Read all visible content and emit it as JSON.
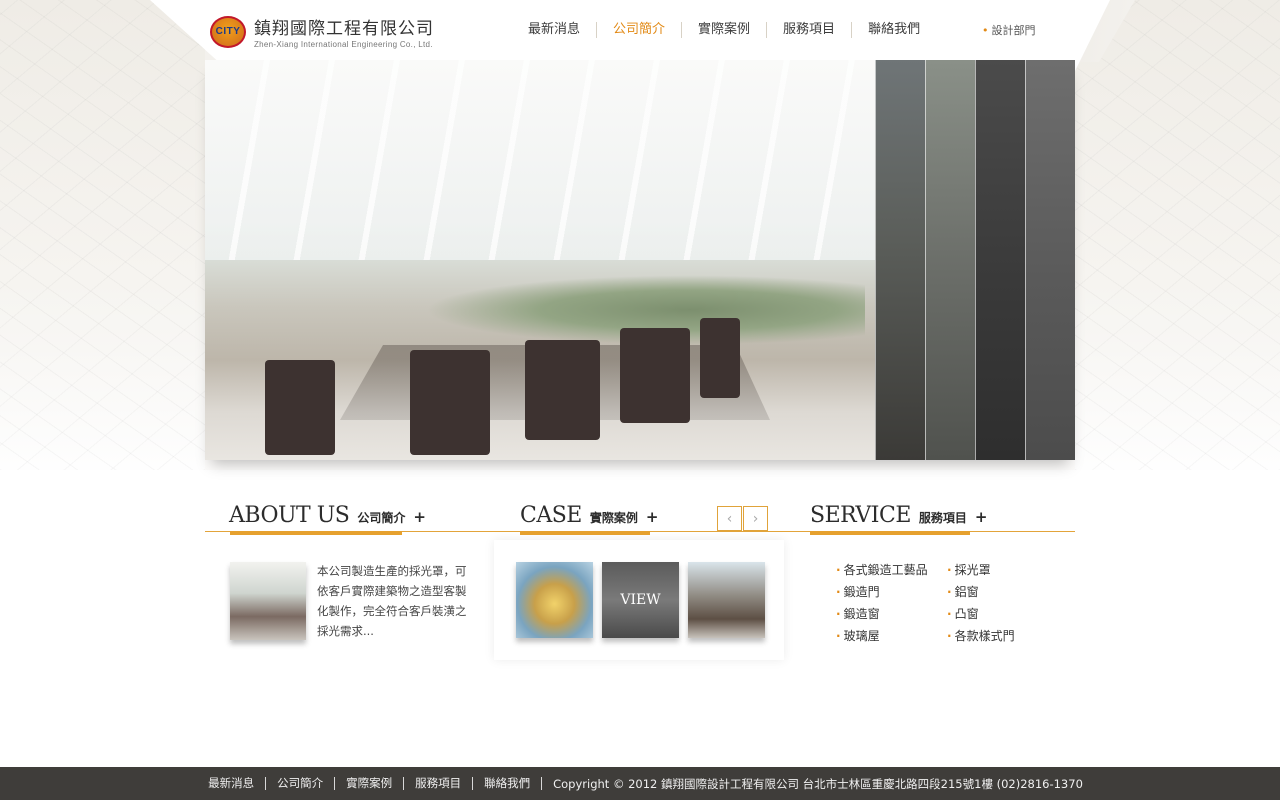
{
  "brand": {
    "logo_badge": "CITY",
    "name_cn": "鎮翔國際工程有限公司",
    "name_en": "Zhen-Xiang International Engineering Co., Ltd."
  },
  "nav": {
    "items": [
      {
        "label": "最新消息",
        "active": false
      },
      {
        "label": "公司簡介",
        "active": true
      },
      {
        "label": "實際案例",
        "active": false
      },
      {
        "label": "服務項目",
        "active": false
      },
      {
        "label": "聯絡我們",
        "active": false
      }
    ],
    "design_link": "設計部門"
  },
  "colors": {
    "accent": "#e28a16",
    "underline": "#e6a12e",
    "footer_bg": "#3f3d3a"
  },
  "about": {
    "title_en": "ABOUT US",
    "title_cn": "公司簡介",
    "plus": "+",
    "text": "本公司製造生產的採光罩，可依客戶實際建築物之造型客製化製作，完全符合客戶裝潢之採光需求..."
  },
  "case": {
    "title_en": "CASE",
    "title_cn": "實際案例",
    "plus": "+",
    "prev_icon": "‹",
    "next_icon": "›",
    "view_label": "VIEW"
  },
  "service": {
    "title_en": "SERVICE",
    "title_cn": "服務項目",
    "plus": "+",
    "items": [
      "各式鍛造工藝品",
      "採光罩",
      "鍛造門",
      "鋁窗",
      "鍛造窗",
      "凸窗",
      "玻璃屋",
      "各款樣式門"
    ]
  },
  "footer": {
    "links": [
      "最新消息",
      "公司簡介",
      "實際案例",
      "服務項目",
      "聯絡我們"
    ],
    "copyright": "Copyright © 2012 鎮翔國際設計工程有限公司  台北市士林區重慶北路四段215號1樓 (02)2816-1370"
  }
}
